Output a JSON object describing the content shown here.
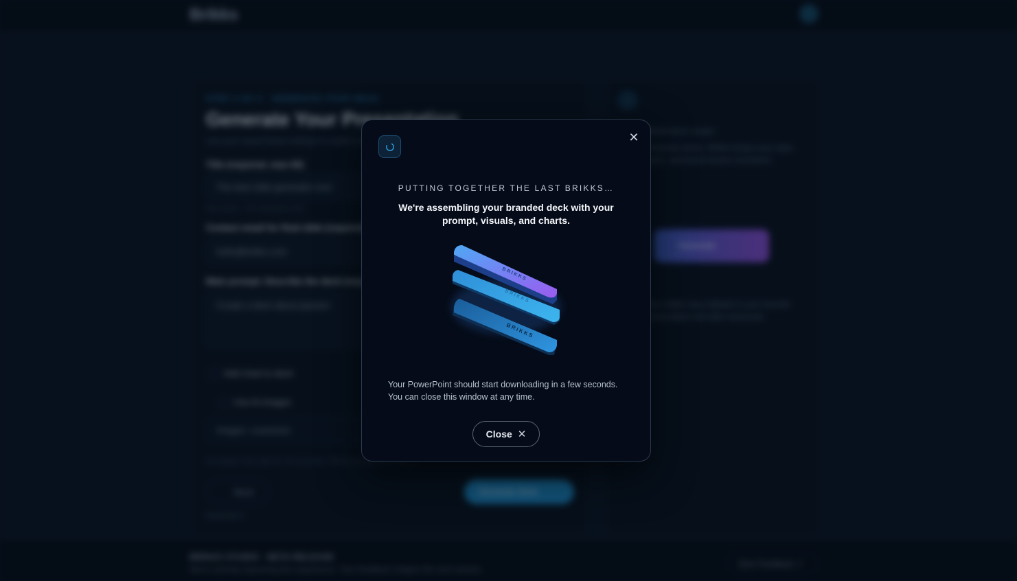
{
  "background_app": {
    "brand": "Brikks",
    "step_label": "STEP 3 OF 3 · GENERATE YOUR DECK",
    "title": "Generate Your Presentation",
    "subtitle": "Use your saved brand settings to create a deck",
    "title_field_label": "Title (required, max 60)",
    "title_field_value": "The best slide generator ever",
    "title_hint": "Max 60ch · 28 characters left",
    "email_field_label": "Contact email for final slide (required)",
    "email_field_value": "hello@brikks.com",
    "prompt_label": "Main prompt: Describe the deck (required)",
    "prompt_value": "Create a deck about passion",
    "checkbox_chart": "Add chart to deck",
    "checkbox_ai_images": "Use AI images",
    "images_hint": "Images: customize",
    "footnote": "AI images may add 20–40 seconds. Fill the prompt to continue.",
    "back_label": "Back",
    "generate_label": "Generate Deck",
    "link_label": "Generate ▾",
    "right_heading": "Brikks",
    "right_text_1": "Brand deck creator",
    "right_text_2": "Generate decks. Brikks keeps your style, fonts, and brand assets consistent.",
    "right_button": "Generate",
    "right_text_3": "Your slides stay editable in your favorite presentation tool after download.",
    "footer_title": "BRIKKS STUDIO · BETA RELEASE",
    "footer_sub": "We're actively improving the experience. Your feedback shapes the next version.",
    "footer_button": "Give Feedback ↗"
  },
  "modal": {
    "eyebrow": "PUTTING TOGETHER THE LAST BRIKKS…",
    "headline": "We're assembling your branded deck with your prompt, visuals, and charts.",
    "illustration_word": "BRIKKS",
    "note_line_1": "Your PowerPoint should start downloading in a few seconds.",
    "note_line_2": "You can close this window at any time.",
    "close_label": "Close",
    "close_x_glyph": "✕",
    "close_icon_glyph": "✕"
  },
  "colors": {
    "accent": "#3aa8e6",
    "modal_bg": "#050b18",
    "gradient_start": "#4fa8f5",
    "gradient_end": "#9b5cf0"
  }
}
